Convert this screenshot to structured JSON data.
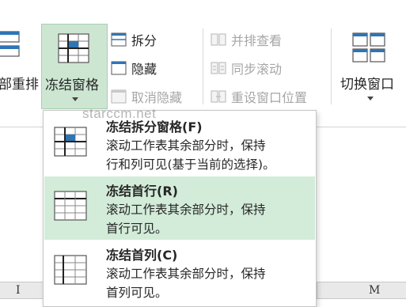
{
  "ribbon": {
    "arrange_all_label": "部重排",
    "freeze_panes_label": "冻结窗格",
    "split_label": "拆分",
    "hide_label": "隐藏",
    "unhide_label": "取消隐藏",
    "side_by_side_label": "并排查看",
    "sync_scroll_label": "同步滚动",
    "reset_position_label": "重设窗口位置",
    "switch_windows_label": "切换窗口"
  },
  "menu": {
    "items": [
      {
        "title": "冻结拆分窗格(F)",
        "desc1": "滚动工作表其余部分时，保持",
        "desc2": "行和列可见(基于当前的选择)。",
        "selected": false
      },
      {
        "title": "冻结首行(R)",
        "desc1": "滚动工作表其余部分时，保持",
        "desc2": "首行可见。",
        "selected": true
      },
      {
        "title": "冻结首列(C)",
        "desc1": "滚动工作表其余部分时，保持",
        "desc2": "首列可见。",
        "selected": false
      }
    ]
  },
  "sheet": {
    "columns": [
      "I",
      "M"
    ]
  },
  "watermark": "starccm.net",
  "colors": {
    "accent_green": "#217346",
    "selected_bg": "#d3ecd9",
    "freeze_btn_bg": "#cde6d2",
    "icon_blue": "#2e75b6"
  }
}
